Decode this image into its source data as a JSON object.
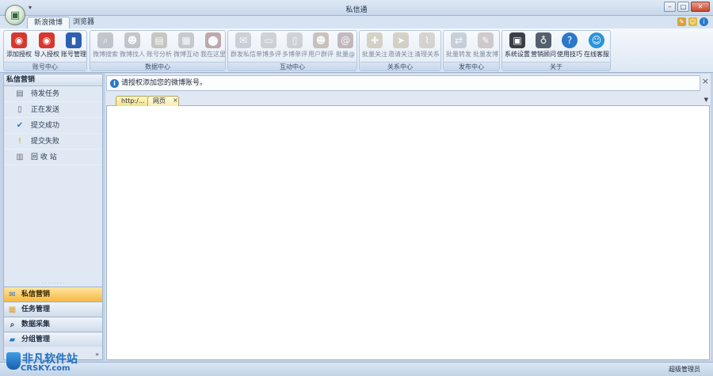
{
  "window": {
    "title": "私信通",
    "qat": "▾"
  },
  "tabs": [
    {
      "label": "新浪微博"
    },
    {
      "label": "浏览器"
    }
  ],
  "ribbon": {
    "groups": [
      {
        "label": "账号中心",
        "buttons": [
          {
            "label": "添加授权"
          },
          {
            "label": "导入授权"
          },
          {
            "label": "账号管理"
          }
        ]
      },
      {
        "label": "数据中心",
        "buttons": [
          {
            "label": "微博搜索"
          },
          {
            "label": "微博找人"
          },
          {
            "label": "账号分析"
          },
          {
            "label": "微博互动"
          },
          {
            "label": "我在这里"
          }
        ]
      },
      {
        "label": "互动中心",
        "buttons": [
          {
            "label": "群发私信"
          },
          {
            "label": "单博多评"
          },
          {
            "label": "多博单评"
          },
          {
            "label": "用户群评"
          },
          {
            "label": "批量@"
          }
        ]
      },
      {
        "label": "关系中心",
        "buttons": [
          {
            "label": "批量关注"
          },
          {
            "label": "邀请关注"
          },
          {
            "label": "清理关系"
          }
        ]
      },
      {
        "label": "发布中心",
        "buttons": [
          {
            "label": "批量转发"
          },
          {
            "label": "批量发博"
          }
        ]
      },
      {
        "label": "关于",
        "buttons": [
          {
            "label": "系统设置"
          },
          {
            "label": "营销顾问"
          },
          {
            "label": "使用技巧"
          },
          {
            "label": "在线客服"
          }
        ]
      }
    ]
  },
  "sidebar": {
    "title": "私信营销",
    "items": [
      {
        "label": "待发任务"
      },
      {
        "label": "正在发送"
      },
      {
        "label": "提交成功"
      },
      {
        "label": "提交失败"
      },
      {
        "label": "回 收 站"
      }
    ],
    "nav": [
      {
        "label": "私信营销"
      },
      {
        "label": "任务管理"
      },
      {
        "label": "数据采集"
      },
      {
        "label": "分组管理"
      }
    ],
    "collapse": "»"
  },
  "notice": {
    "text": "请授权添加您的微博账号。",
    "close": "×"
  },
  "browser_tabs": [
    {
      "label": "http:/..."
    },
    {
      "label": "网页"
    }
  ],
  "browser_tab_close": "×",
  "status": {
    "user": "超级管理员"
  },
  "watermark": {
    "text": "非凡软件站",
    "sub": "CRSKY.com"
  }
}
